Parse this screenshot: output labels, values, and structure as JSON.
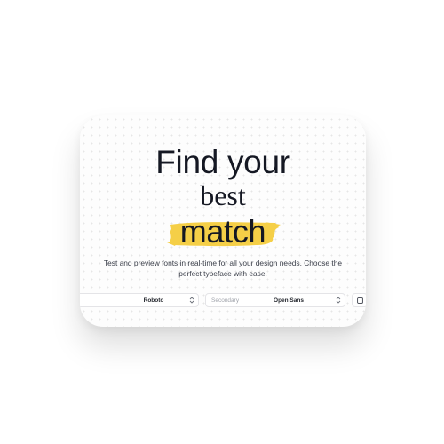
{
  "hero": {
    "line1": "Find your",
    "line2": "best",
    "line3": "match",
    "highlight_color": "#f5cf47",
    "description": "Test and preview fonts in real-time for all your design needs. Choose the perfect typeface with ease."
  },
  "controls": {
    "primary": {
      "label": "",
      "value": "Roboto"
    },
    "secondary": {
      "label": "Secondary",
      "value": "Open Sans"
    },
    "extra_icon": "square-icon"
  },
  "colors": {
    "text": "#151823",
    "background": "#ffffff"
  }
}
